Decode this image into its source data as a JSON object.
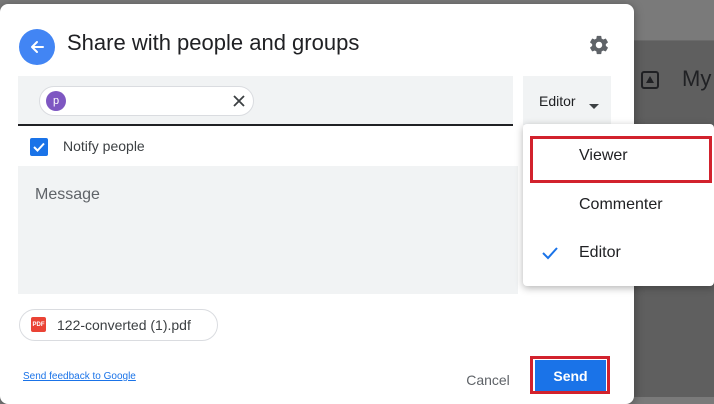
{
  "dialog": {
    "title": "Share with people and groups",
    "back_icon": "arrow-left-icon",
    "settings_icon": "gear-icon"
  },
  "recipient": {
    "avatar_letter": "p",
    "remove_icon": "close-icon"
  },
  "role_dropdown": {
    "selected": "Editor",
    "caret_icon": "caret-down-icon"
  },
  "role_menu": {
    "items": [
      {
        "label": "Viewer",
        "checked": false
      },
      {
        "label": "Commenter",
        "checked": false
      },
      {
        "label": "Editor",
        "checked": true
      }
    ]
  },
  "notify": {
    "label": "Notify people",
    "checked": true
  },
  "message": {
    "placeholder": "Message"
  },
  "attachment": {
    "file_name": "122-converted (1).pdf",
    "icon": "pdf-icon"
  },
  "footer": {
    "feedback_link": "Send feedback to Google",
    "cancel_label": "Cancel",
    "send_label": "Send"
  },
  "background": {
    "partial_text": "My"
  },
  "colors": {
    "accent": "#1a73e8",
    "highlight_box": "#d2222d",
    "avatar": "#7e57c2"
  }
}
